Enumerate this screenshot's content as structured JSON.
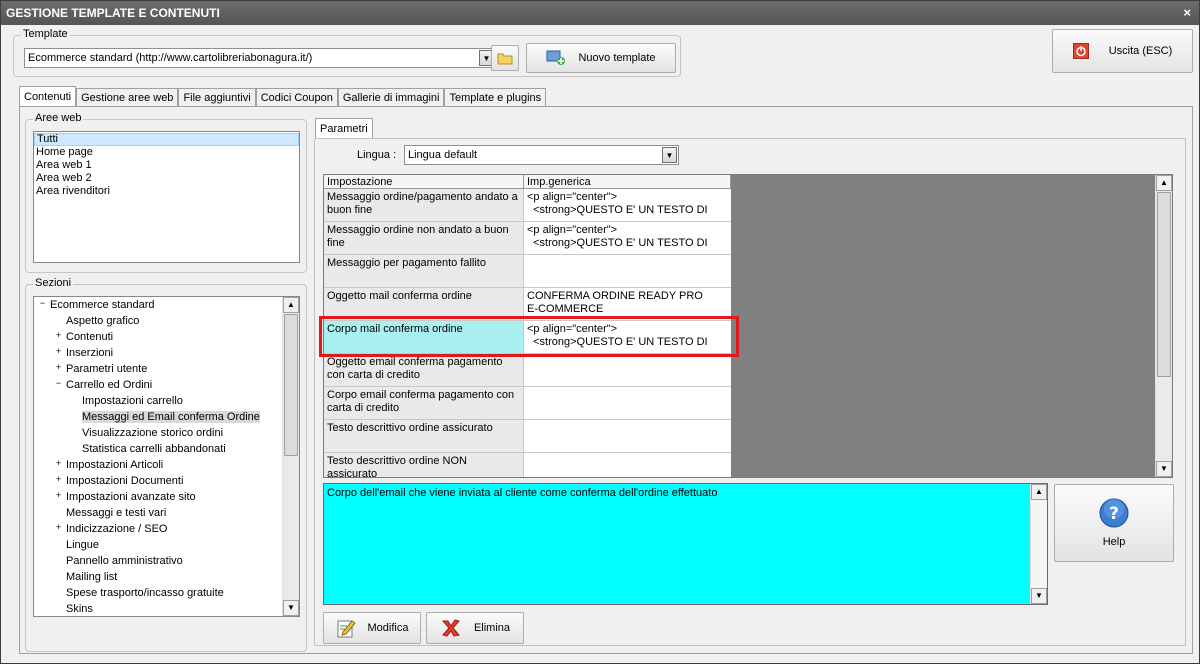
{
  "window": {
    "title": "GESTIONE TEMPLATE E CONTENUTI",
    "close_label": "×"
  },
  "template_group": {
    "label": "Template",
    "selected_template": "Ecommerce standard (http://www.cartolibreriabonagura.it/)",
    "new_template_label": "Nuovo template"
  },
  "exit_button": {
    "label": "Uscita (ESC)"
  },
  "tabs": [
    {
      "label": "Contenuti",
      "active": true
    },
    {
      "label": "Gestione aree web"
    },
    {
      "label": "File aggiuntivi"
    },
    {
      "label": "Codici Coupon"
    },
    {
      "label": "Gallerie di immagini"
    },
    {
      "label": "Template e plugins"
    }
  ],
  "aree_web": {
    "label": "Aree web",
    "items": [
      "Tutti",
      "Home page",
      "Area web 1",
      "Area web 2",
      "Area rivenditori"
    ],
    "selected_index": 0
  },
  "sezioni": {
    "label": "Sezioni",
    "items": [
      {
        "label": "Ecommerce standard",
        "level": 0,
        "expander": "−"
      },
      {
        "label": "Aspetto grafico",
        "level": 1,
        "expander": ""
      },
      {
        "label": "Contenuti",
        "level": 1,
        "expander": "+"
      },
      {
        "label": "Inserzioni",
        "level": 1,
        "expander": "+"
      },
      {
        "label": "Parametri utente",
        "level": 1,
        "expander": "+"
      },
      {
        "label": "Carrello ed Ordini",
        "level": 1,
        "expander": "−"
      },
      {
        "label": "Impostazioni carrello",
        "level": 2,
        "expander": ""
      },
      {
        "label": "Messaggi ed Email conferma Ordine",
        "level": 2,
        "expander": "",
        "highlight": true
      },
      {
        "label": "Visualizzazione storico ordini",
        "level": 2,
        "expander": ""
      },
      {
        "label": "Statistica carrelli abbandonati",
        "level": 2,
        "expander": ""
      },
      {
        "label": "Impostazioni Articoli",
        "level": 1,
        "expander": "+"
      },
      {
        "label": "Impostazioni Documenti",
        "level": 1,
        "expander": "+"
      },
      {
        "label": "Impostazioni avanzate sito",
        "level": 1,
        "expander": "+"
      },
      {
        "label": "Messaggi e testi vari",
        "level": 1,
        "expander": ""
      },
      {
        "label": "Indicizzazione / SEO",
        "level": 1,
        "expander": "+"
      },
      {
        "label": "Lingue",
        "level": 1,
        "expander": ""
      },
      {
        "label": "Pannello amministrativo",
        "level": 1,
        "expander": ""
      },
      {
        "label": "Mailing list",
        "level": 1,
        "expander": ""
      },
      {
        "label": "Spese trasporto/incasso gratuite",
        "level": 1,
        "expander": ""
      },
      {
        "label": "Skins",
        "level": 1,
        "expander": ""
      }
    ]
  },
  "parametri": {
    "tab_label": "Parametri",
    "lingua_label": "Lingua :",
    "lingua_value": "Lingua default",
    "columns": [
      "Impostazione",
      "Imp.generica"
    ],
    "rows": [
      {
        "label": "Messaggio ordine/pagamento andato a buon fine",
        "value": "<p align=\"center\">\n  <strong>QUESTO E' UN TESTO DI"
      },
      {
        "label": "Messaggio ordine non andato a buon fine",
        "value": "<p align=\"center\">\n  <strong>QUESTO E' UN TESTO DI"
      },
      {
        "label": "Messaggio per pagamento fallito",
        "value": ""
      },
      {
        "label": "Oggetto mail conferma ordine",
        "value": "CONFERMA ORDINE READY PRO\nE-COMMERCE"
      },
      {
        "label": "Corpo mail conferma ordine",
        "value": "<p align=\"center\">\n  <strong>QUESTO E' UN TESTO DI",
        "selected": true
      },
      {
        "label": "Oggetto email conferma pagamento con carta di credito",
        "value": ""
      },
      {
        "label": "Corpo email conferma pagamento con carta di credito",
        "value": ""
      },
      {
        "label": "Testo descrittivo ordine assicurato",
        "value": ""
      },
      {
        "label": "Testo descrittivo ordine NON assicurato",
        "value": ""
      }
    ],
    "description": "Corpo dell'email che viene inviata al cliente come conferma dell'ordine effettuato"
  },
  "help_button": {
    "label": "Help"
  },
  "actions": {
    "modifica_label": "Modifica",
    "elimina_label": "Elimina"
  },
  "colors": {
    "selected_row": "#aaf0f0",
    "description_bg": "#00ffff",
    "highlight_border": "#e01919"
  }
}
